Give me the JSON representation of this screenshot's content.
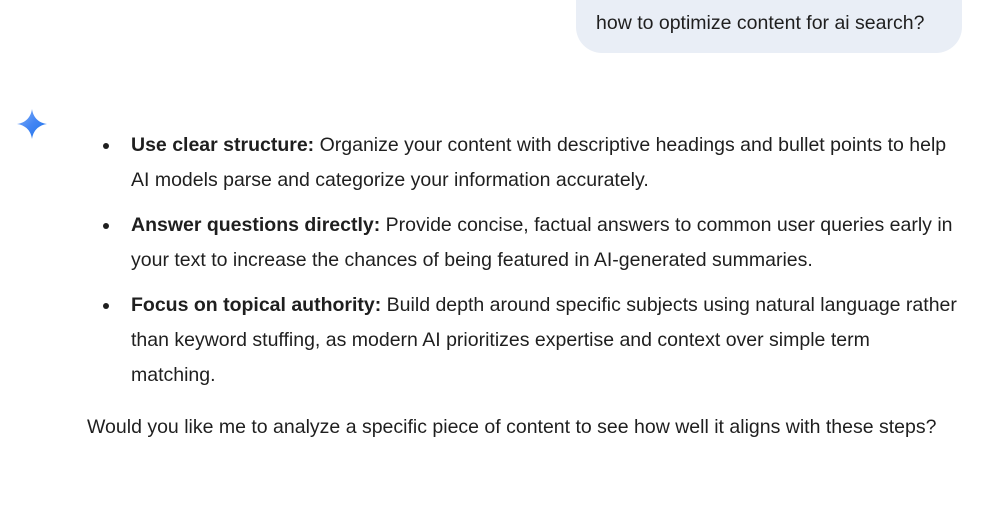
{
  "user_message": {
    "text": "how to optimize content for ai search?"
  },
  "assistant": {
    "icon": "gemini-sparkle-icon",
    "icon_colors": [
      "#4285f4",
      "#1a73e8",
      "#8ab4f8"
    ],
    "bullets": [
      {
        "heading": "Use clear structure:",
        "text": "Organize your content with descriptive headings and bullet points to help AI models parse and categorize your information accurately."
      },
      {
        "heading": "Answer questions directly:",
        "text": "Provide concise, factual answers to common user queries early in your text to increase the chances of being featured in AI-generated summaries."
      },
      {
        "heading": "Focus on topical authority:",
        "text": "Build depth around specific subjects using natural language rather than keyword stuffing, as modern AI prioritizes expertise and context over simple term matching."
      }
    ],
    "followup": "Would you like me to analyze a specific piece of content to see how well it aligns with these steps?"
  },
  "colors": {
    "user_bubble_bg": "#e9eef6",
    "text": "#1f1f1f"
  }
}
